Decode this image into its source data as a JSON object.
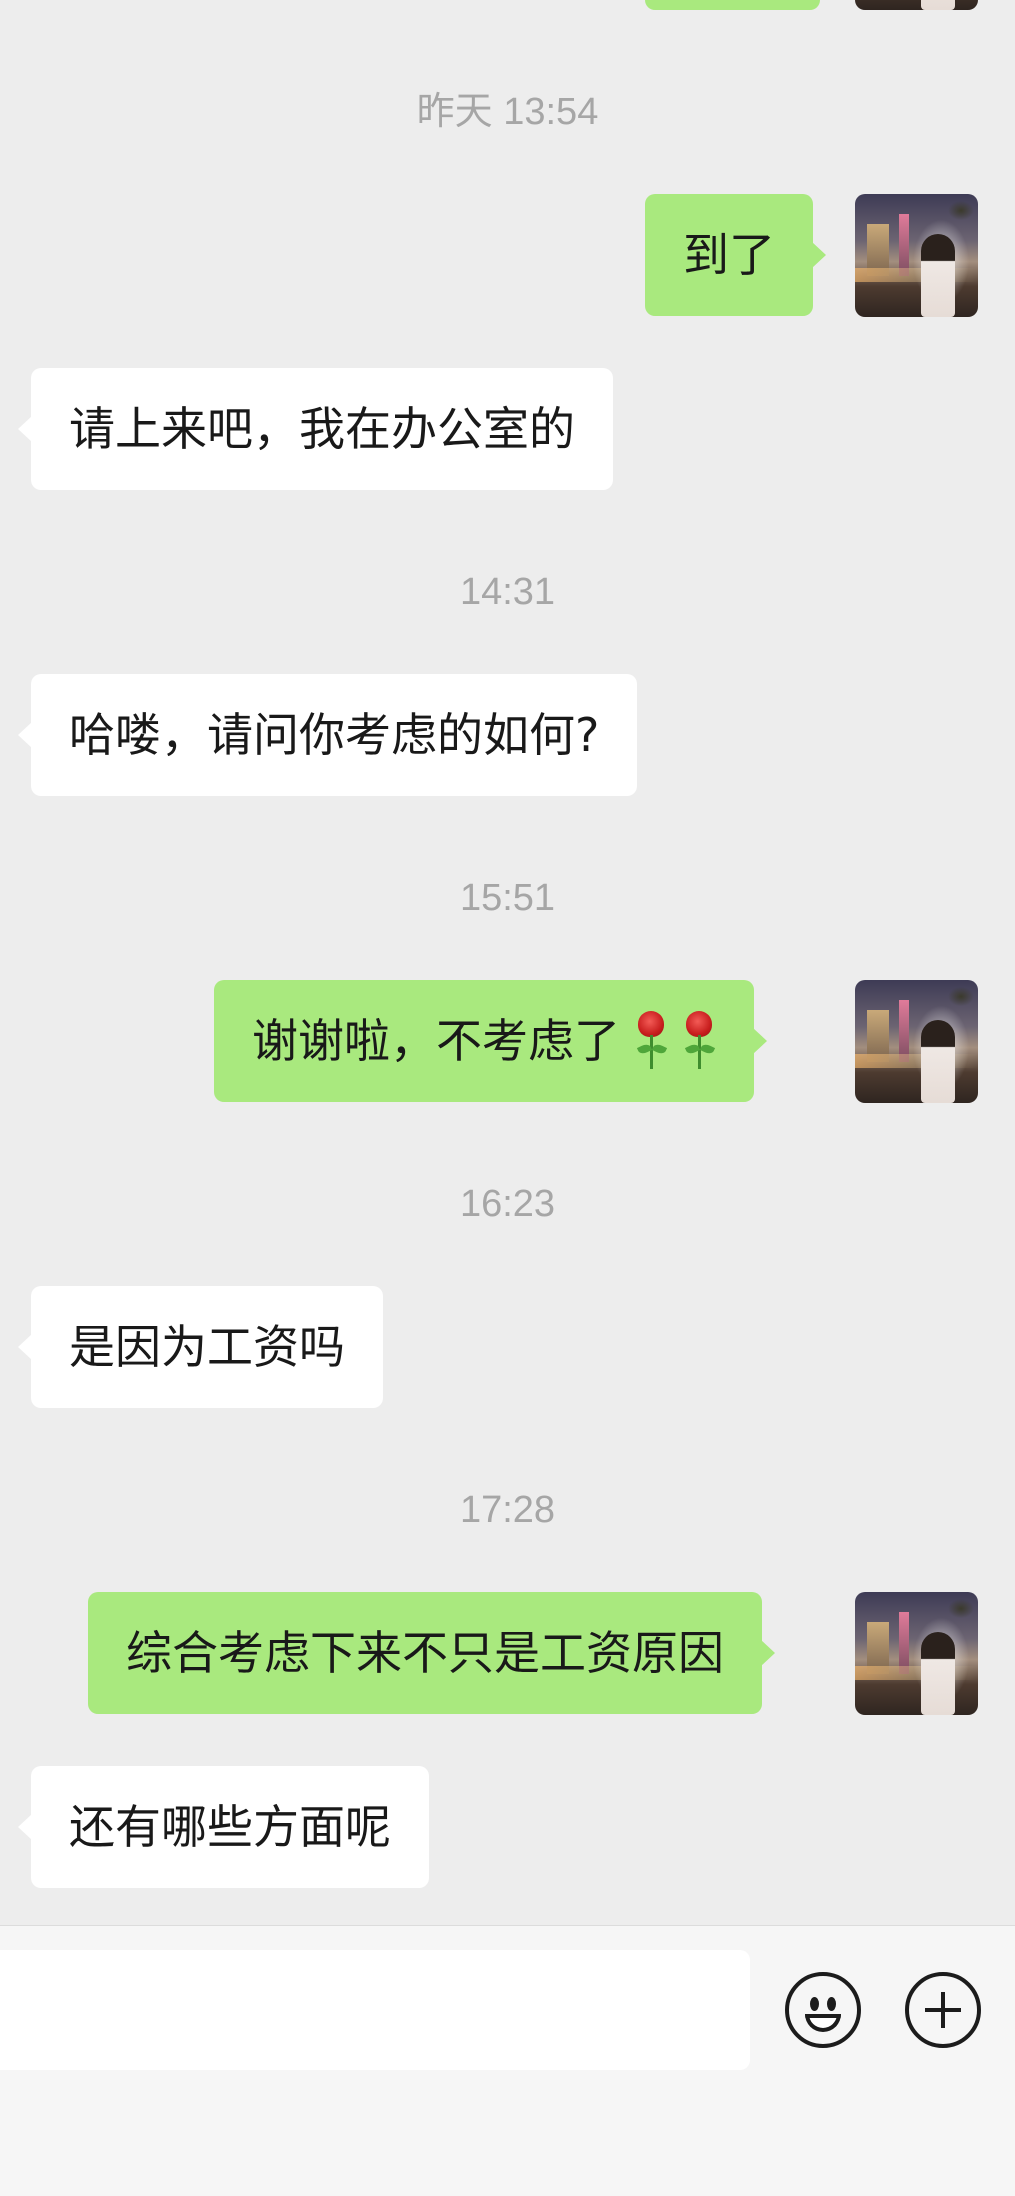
{
  "chat": {
    "timestamps": [
      "昨天 13:54",
      "14:31",
      "15:51",
      "16:23",
      "17:28"
    ],
    "messages": [
      {
        "side": "out",
        "text": "到了"
      },
      {
        "side": "in",
        "text": "请上来吧，我在办公室的"
      },
      {
        "side": "in",
        "text": "哈喽，请问你考虑的如何?"
      },
      {
        "side": "out",
        "text": "谢谢啦，不考虑了",
        "emoji": [
          "rose-icon",
          "rose-icon"
        ]
      },
      {
        "side": "in",
        "text": "是因为工资吗"
      },
      {
        "side": "out",
        "text": "综合考虑下来不只是工资原因"
      },
      {
        "side": "in",
        "text": "还有哪些方面呢"
      }
    ]
  },
  "input_bar": {
    "icons": [
      "smiley-icon",
      "plus-circle-icon"
    ]
  },
  "colors": {
    "background": "#ededed",
    "outgoing_bubble": "#a9e97e",
    "incoming_bubble": "#ffffff",
    "timestamp_text": "#a6a6a6",
    "input_bar": "#f6f6f6"
  }
}
